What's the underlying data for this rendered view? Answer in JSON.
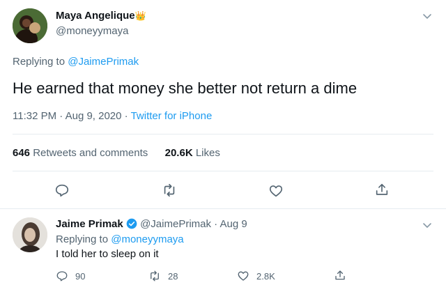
{
  "tweet": {
    "author_name": "Maya Angelique",
    "author_emoji": "👑",
    "author_handle": "@moneyymaya",
    "replying_prefix": "Replying to",
    "replying_handle": "@JaimePrimak",
    "text": "He earned that money she better not return a dime",
    "time": "11:32 PM · Aug 9, 2020 · ",
    "source": "Twitter for iPhone",
    "retweets_count": "646",
    "retweets_label": "Retweets and comments",
    "likes_count": "20.6K",
    "likes_label": "Likes"
  },
  "reply": {
    "author_name": "Jaime Primak",
    "author_handle": "@JaimePrimak",
    "date": "· Aug 9",
    "replying_prefix": "Replying to",
    "replying_handle": "@moneyymaya",
    "text": "I told her to sleep on it",
    "reply_count": "90",
    "retweet_count": "28",
    "like_count": "2.8K"
  },
  "colors": {
    "accent": "#1d9bf0",
    "secondary_text": "#536471",
    "divider": "#e6ecf0"
  },
  "icons": [
    "chevron-down-icon",
    "reply-icon",
    "retweet-icon",
    "heart-icon",
    "share-icon",
    "verified-icon"
  ]
}
